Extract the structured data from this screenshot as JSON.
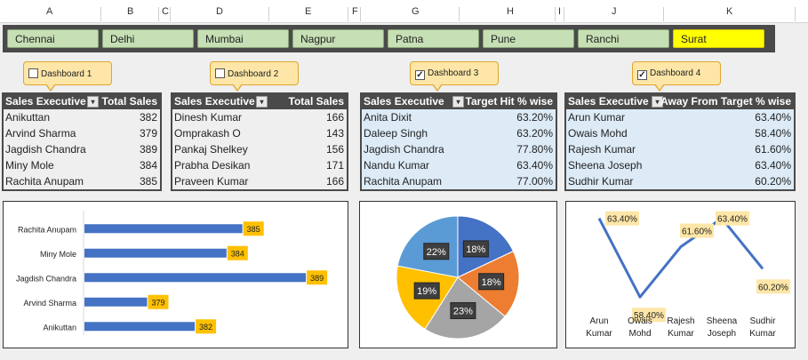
{
  "columns": [
    "A",
    "B",
    "C",
    "D",
    "E",
    "F",
    "G",
    "H",
    "I",
    "J",
    "K"
  ],
  "cities": [
    {
      "label": "Chennai",
      "selected": false
    },
    {
      "label": "Delhi",
      "selected": false
    },
    {
      "label": "Mumbai",
      "selected": false
    },
    {
      "label": "Nagpur",
      "selected": false
    },
    {
      "label": "Patna",
      "selected": false
    },
    {
      "label": "Pune",
      "selected": false
    },
    {
      "label": "Ranchi",
      "selected": false
    },
    {
      "label": "Surat",
      "selected": true
    }
  ],
  "dashboards": [
    {
      "label": "Dashboard 1",
      "checked": false,
      "mark": ""
    },
    {
      "label": "Dashboard 2",
      "checked": false,
      "mark": ""
    },
    {
      "label": "Dashboard 3",
      "checked": true,
      "mark": "✓"
    },
    {
      "label": "Dashboard 4",
      "checked": true,
      "mark": "✓"
    }
  ],
  "tables": [
    {
      "col1": "Sales Executive",
      "col2": "Total Sales",
      "rows": [
        {
          "name": "Anikuttan",
          "value": "382"
        },
        {
          "name": "Arvind Sharma",
          "value": "379"
        },
        {
          "name": "Jagdish Chandra",
          "value": "389"
        },
        {
          "name": "Miny Mole",
          "value": "384"
        },
        {
          "name": "Rachita Anupam",
          "value": "385"
        }
      ]
    },
    {
      "col1": "Sales Executive",
      "col2": "Total Sales",
      "rows": [
        {
          "name": "Dinesh Kumar",
          "value": "166"
        },
        {
          "name": "Omprakash O",
          "value": "143"
        },
        {
          "name": "Pankaj Shelkey",
          "value": "156"
        },
        {
          "name": "Prabha Desikan",
          "value": "171"
        },
        {
          "name": "Praveen Kumar",
          "value": "166"
        }
      ]
    },
    {
      "col1": "Sales Executive",
      "col2": "Target Hit % wise",
      "rows": [
        {
          "name": "Anita Dixit",
          "value": "63.20%"
        },
        {
          "name": "Daleep Singh",
          "value": "63.20%"
        },
        {
          "name": "Jagdish Chandra",
          "value": "77.80%"
        },
        {
          "name": "Nandu Kumar",
          "value": "63.40%"
        },
        {
          "name": "Rachita Anupam",
          "value": "77.00%"
        }
      ]
    },
    {
      "col1": "Sales Executive",
      "col2": "Away From Target % wise",
      "rows": [
        {
          "name": "Arun Kumar",
          "value": "63.40%"
        },
        {
          "name": "Owais Mohd",
          "value": "58.40%"
        },
        {
          "name": "Rajesh Kumar",
          "value": "61.60%"
        },
        {
          "name": "Sheena Joseph",
          "value": "63.40%"
        },
        {
          "name": "Sudhir Kumar",
          "value": "60.20%"
        }
      ]
    }
  ],
  "chart_data": [
    {
      "type": "bar",
      "categories": [
        "Rachita Anupam",
        "Miny Mole",
        "Jagdish Chandra",
        "Arvind Sharma",
        "Anikuttan"
      ],
      "values": [
        385,
        384,
        389,
        379,
        382
      ],
      "labels": [
        "385",
        "384",
        "389",
        "379",
        "382"
      ],
      "xlim": [
        375,
        390
      ],
      "bar_color": "#4472c4",
      "label_color": "#ffc000"
    },
    {
      "type": "pie",
      "values": [
        18,
        18,
        23,
        19,
        22
      ],
      "labels": [
        "18%",
        "18%",
        "23%",
        "19%",
        "22%"
      ],
      "colors": [
        "#4472c4",
        "#ed7d31",
        "#a5a5a5",
        "#ffc000",
        "#5b9bd5"
      ]
    },
    {
      "type": "line",
      "categories": [
        [
          "Arun",
          "Kumar"
        ],
        [
          "Owais",
          "Mohd"
        ],
        [
          "Rajesh",
          "Kumar"
        ],
        [
          "Sheena",
          "Joseph"
        ],
        [
          "Sudhir",
          "Kumar"
        ]
      ],
      "values": [
        63.4,
        58.4,
        61.6,
        63.4,
        60.2
      ],
      "labels": [
        "63.40%",
        "58.40%",
        "61.60%",
        "63.40%",
        "60.20%"
      ],
      "ylim": [
        57,
        64
      ],
      "line_color": "#4472c4",
      "label_color": "#fde6a7"
    }
  ]
}
